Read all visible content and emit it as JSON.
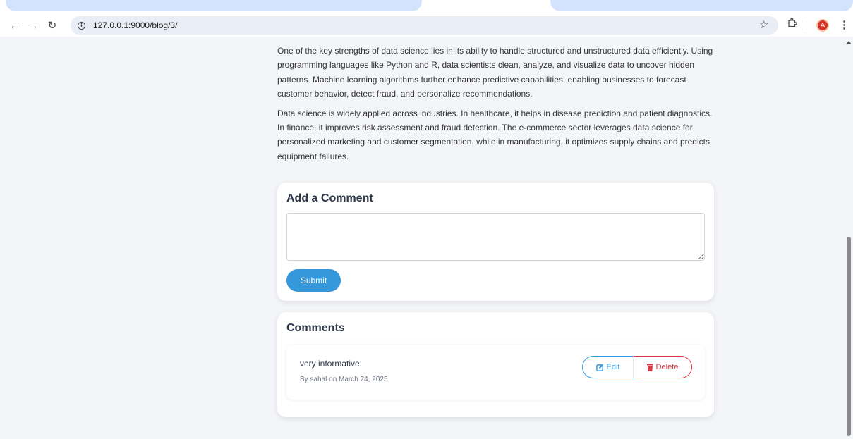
{
  "browser": {
    "url": "127.0.0.1:9000/blog/3/",
    "avatar_letter": "A",
    "icons": [
      "back-icon",
      "forward-icon",
      "reload-icon",
      "info-icon",
      "star-icon",
      "extensions-icon",
      "menu-icon"
    ]
  },
  "article": {
    "paragraphs": [
      "One of the key strengths of data science lies in its ability to handle structured and unstructured data efficiently. Using programming languages like Python and R, data scientists clean, analyze, and visualize data to uncover hidden patterns. Machine learning algorithms further enhance predictive capabilities, enabling businesses to forecast customer behavior, detect fraud, and personalize recommendations.",
      "Data science is widely applied across industries. In healthcare, it helps in disease prediction and patient diagnostics. In finance, it improves risk assessment and fraud detection. The e-commerce sector leverages data science for personalized marketing and customer segmentation, while in manufacturing, it optimizes supply chains and predicts equipment failures."
    ]
  },
  "comment_form": {
    "title": "Add a Comment",
    "textarea_value": "",
    "submit_label": "Submit"
  },
  "comments": {
    "title": "Comments",
    "items": [
      {
        "text": "very informative",
        "meta": "By sahal on March 24, 2025",
        "edit_label": "Edit",
        "delete_label": "Delete"
      }
    ]
  },
  "colors": {
    "accent": "#3498db",
    "danger": "#dc3545"
  }
}
